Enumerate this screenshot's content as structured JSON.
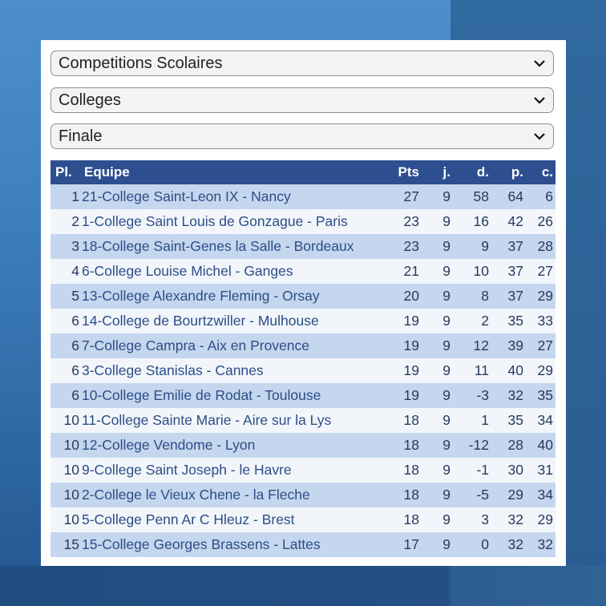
{
  "selects": [
    {
      "value": "Competitions Scolaires"
    },
    {
      "value": "Colleges"
    },
    {
      "value": "Finale"
    }
  ],
  "table": {
    "headers": {
      "pl": "Pl.",
      "team": "Equipe",
      "pts": "Pts",
      "j": "j.",
      "d": "d.",
      "p": "p.",
      "c": "c."
    },
    "rows": [
      {
        "pl": "1",
        "team": "21-College Saint-Leon IX - Nancy",
        "pts": "27",
        "j": "9",
        "d": "58",
        "p": "64",
        "c": "6"
      },
      {
        "pl": "2",
        "team": "1-College Saint Louis de Gonzague - Paris",
        "pts": "23",
        "j": "9",
        "d": "16",
        "p": "42",
        "c": "26"
      },
      {
        "pl": "3",
        "team": "18-College Saint-Genes la Salle - Bordeaux",
        "pts": "23",
        "j": "9",
        "d": "9",
        "p": "37",
        "c": "28"
      },
      {
        "pl": "4",
        "team": "6-College Louise Michel - Ganges",
        "pts": "21",
        "j": "9",
        "d": "10",
        "p": "37",
        "c": "27"
      },
      {
        "pl": "5",
        "team": "13-College Alexandre Fleming - Orsay",
        "pts": "20",
        "j": "9",
        "d": "8",
        "p": "37",
        "c": "29"
      },
      {
        "pl": "6",
        "team": "14-College de Bourtzwiller - Mulhouse",
        "pts": "19",
        "j": "9",
        "d": "2",
        "p": "35",
        "c": "33"
      },
      {
        "pl": "6",
        "team": "7-College Campra - Aix en Provence",
        "pts": "19",
        "j": "9",
        "d": "12",
        "p": "39",
        "c": "27"
      },
      {
        "pl": "6",
        "team": "3-College Stanislas - Cannes",
        "pts": "19",
        "j": "9",
        "d": "11",
        "p": "40",
        "c": "29"
      },
      {
        "pl": "6",
        "team": "10-College Emilie de Rodat - Toulouse",
        "pts": "19",
        "j": "9",
        "d": "-3",
        "p": "32",
        "c": "35"
      },
      {
        "pl": "10",
        "team": "11-College Sainte Marie - Aire sur la Lys",
        "pts": "18",
        "j": "9",
        "d": "1",
        "p": "35",
        "c": "34"
      },
      {
        "pl": "10",
        "team": "12-College Vendome - Lyon",
        "pts": "18",
        "j": "9",
        "d": "-12",
        "p": "28",
        "c": "40"
      },
      {
        "pl": "10",
        "team": "9-College Saint Joseph - le Havre",
        "pts": "18",
        "j": "9",
        "d": "-1",
        "p": "30",
        "c": "31"
      },
      {
        "pl": "10",
        "team": "2-College le Vieux Chene - la Fleche",
        "pts": "18",
        "j": "9",
        "d": "-5",
        "p": "29",
        "c": "34"
      },
      {
        "pl": "10",
        "team": "5-College Penn Ar C Hleuz - Brest",
        "pts": "18",
        "j": "9",
        "d": "3",
        "p": "32",
        "c": "29"
      },
      {
        "pl": "15",
        "team": "15-College Georges Brassens - Lattes",
        "pts": "17",
        "j": "9",
        "d": "0",
        "p": "32",
        "c": "32"
      }
    ]
  }
}
